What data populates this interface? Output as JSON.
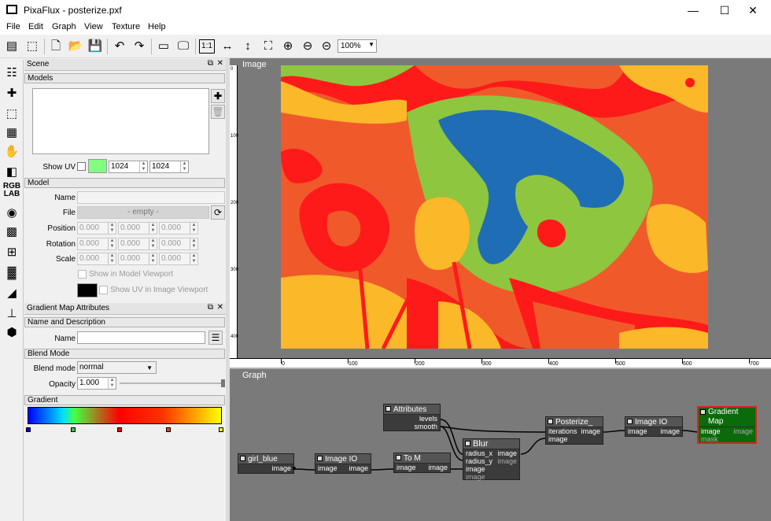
{
  "window": {
    "title": "PixaFlux - posterize.pxf",
    "minimize": "—",
    "maximize": "☐",
    "close": "✕"
  },
  "menu": [
    "File",
    "Edit",
    "Graph",
    "View",
    "Texture",
    "Help"
  ],
  "toolbar": {
    "zoom": "100%"
  },
  "scene": {
    "title": "Scene",
    "models_section": "Models",
    "show_uv_label": "Show UV",
    "uv_color": "#80ff80",
    "uv_w": "1024",
    "uv_h": "1024",
    "model_section": "Model",
    "name_label": "Name",
    "file_label": "File",
    "file_value": "- empty -",
    "position_label": "Position",
    "rotation_label": "Rotation",
    "scale_label": "Scale",
    "pos": [
      "0.000",
      "0.000",
      "0.000"
    ],
    "rot": [
      "0.000",
      "0.000",
      "0.000"
    ],
    "scl": [
      "0.000",
      "0.000",
      "0.000"
    ],
    "show_in_viewport": "Show in Model Viewport",
    "show_uv_image": "Show UV in Image Viewport"
  },
  "gradient_panel": {
    "title": "Gradient Map Attributes",
    "name_section": "Name and Description",
    "name_label": "Name",
    "blend_section": "Blend Mode",
    "blend_label": "Blend mode",
    "blend_value": "normal",
    "opacity_label": "Opacity",
    "opacity_value": "1.000",
    "gradient_section": "Gradient",
    "stops": [
      "#0000ff",
      "#33cc33",
      "#ff0000",
      "#ff4400",
      "#ffff00"
    ]
  },
  "image_view": {
    "label": "Image",
    "hruler": [
      "0",
      "100",
      "200",
      "300",
      "400",
      "500",
      "600",
      "700"
    ],
    "vruler": [
      "0",
      "100",
      "200",
      "300",
      "400"
    ]
  },
  "graph_view": {
    "label": "Graph",
    "nodes": {
      "girl_blue": {
        "title": "girl_blue",
        "out": "image"
      },
      "imageio1": {
        "title": "Image IO",
        "in": "image",
        "out": "image"
      },
      "tom": {
        "title": "To M",
        "in": "image",
        "out": "image"
      },
      "attributes": {
        "title": "Attributes",
        "p1": "levels",
        "p2": "smooth"
      },
      "blur": {
        "title": "Blur",
        "p1": "radius_x",
        "p2": "radius_y",
        "p3": "image",
        "p4": "image",
        "o1": "image",
        "o2": "image"
      },
      "posterize": {
        "title": "Posterize_",
        "p1": "iterations",
        "p2": "image",
        "o1": "image"
      },
      "imageio2": {
        "title": "Image IO",
        "in": "image",
        "out": "image"
      },
      "gradmap": {
        "title": "Gradient Map",
        "p1": "image",
        "p2": "mask",
        "o1": "image"
      }
    }
  }
}
